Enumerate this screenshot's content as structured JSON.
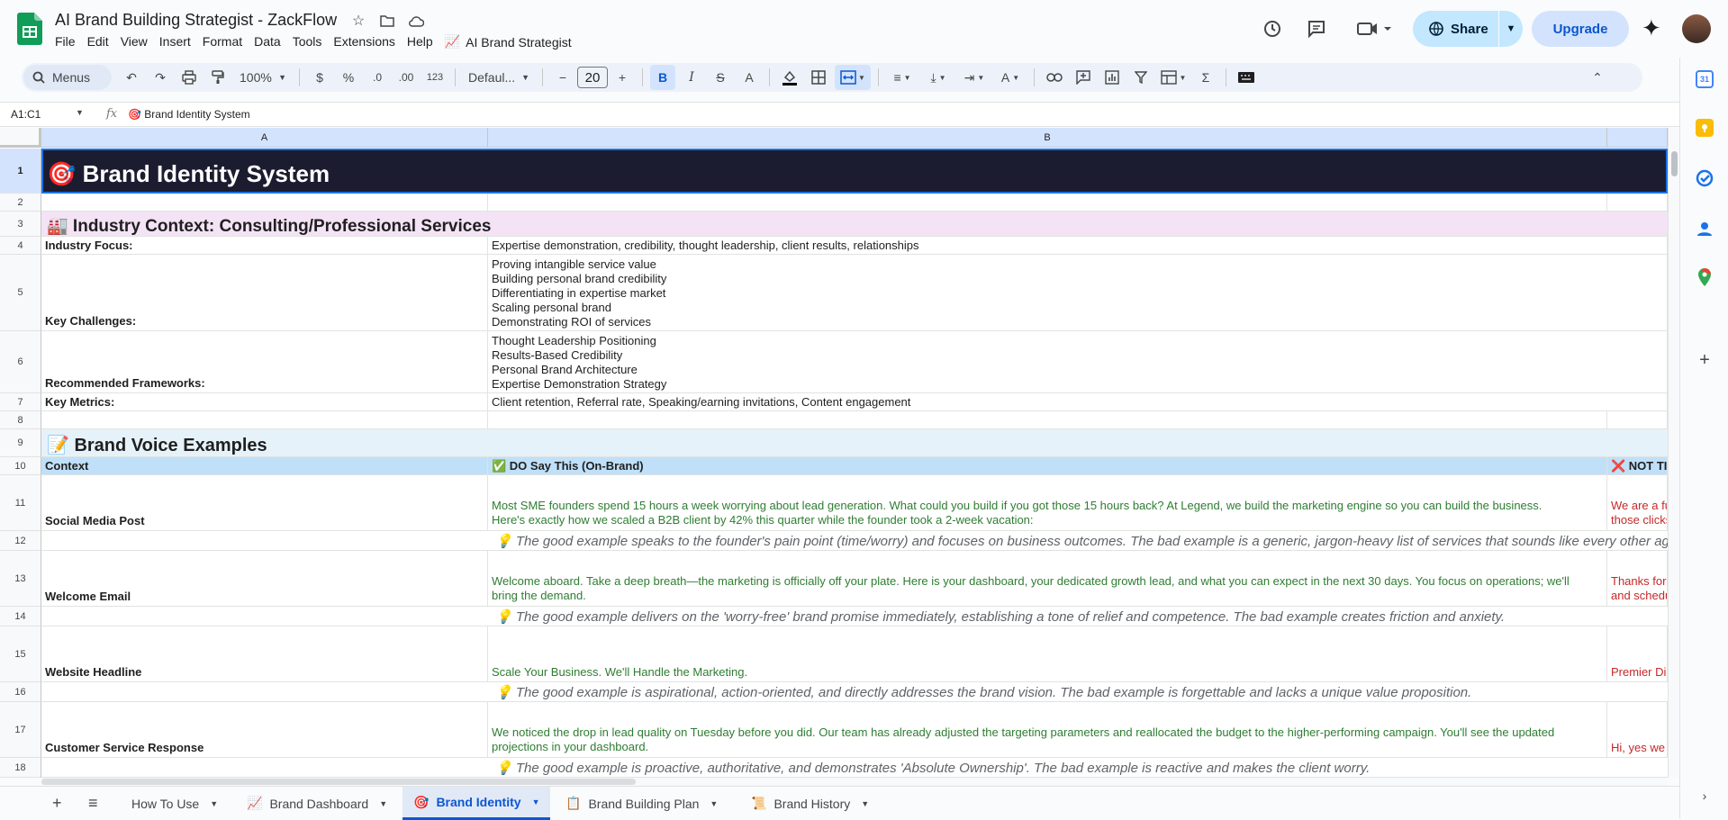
{
  "app": {
    "title": "AI Brand Building Strategist - ZackFlow",
    "menu": [
      "File",
      "Edit",
      "View",
      "Insert",
      "Format",
      "Data",
      "Tools",
      "Extensions",
      "Help"
    ],
    "extension_menu": "AI Brand Strategist",
    "share_label": "Share",
    "upgrade_label": "Upgrade"
  },
  "toolbar": {
    "menus_label": "Menus",
    "zoom": "100%",
    "currency": "$",
    "percent": "%",
    "dec_decrease": ".0",
    "dec_increase": ".00",
    "number_format": "123",
    "font": "Defaul...",
    "font_size": "20"
  },
  "formula_bar": {
    "name_box": "A1:C1",
    "fx": "fx",
    "content": "🎯 Brand Identity System"
  },
  "columns": [
    "A",
    "B"
  ],
  "rows": {
    "r1": {
      "num": "1",
      "text": "🎯 Brand Identity System"
    },
    "r2": {
      "num": "2"
    },
    "r3": {
      "num": "3",
      "text": "🏭 Industry Context: Consulting/Professional Services"
    },
    "r4": {
      "num": "4",
      "a": "Industry Focus:",
      "b": "Expertise demonstration, credibility, thought leadership, client results, relationships"
    },
    "r5": {
      "num": "5",
      "a": "Key Challenges:",
      "b": "Proving intangible service value\nBuilding personal brand credibility\nDifferentiating in expertise market\nScaling personal brand\nDemonstrating ROI of services"
    },
    "r6": {
      "num": "6",
      "a": "Recommended Frameworks:",
      "b": "Thought Leadership Positioning\nResults-Based Credibility\nPersonal Brand Architecture\nExpertise Demonstration Strategy"
    },
    "r7": {
      "num": "7",
      "a": "Key Metrics:",
      "b": "Client retention, Referral rate, Speaking/earning invitations, Content engagement"
    },
    "r8": {
      "num": "8"
    },
    "r9": {
      "num": "9",
      "text": "📝 Brand Voice Examples"
    },
    "r10": {
      "num": "10",
      "a": "Context",
      "b": "✅ DO Say This (On-Brand)",
      "c": "❌ NOT TI"
    },
    "r11": {
      "num": "11",
      "a": "Social Media Post",
      "b": "Most SME founders spend 15 hours a week worrying about lead generation. What could you build if you got those 15 hours back? At Legend, we build the marketing engine so you can build the business.\nHere's exactly how we scaled a B2B client by 42% this quarter while the founder took a 2-week vacation:",
      "c": "We are a fu\nthose clicks"
    },
    "r12": {
      "num": "12",
      "note": "💡 The good example speaks to the founder's pain point (time/worry) and focuses on business outcomes. The bad example is a generic, jargon-heavy list of services that sounds like every other agency."
    },
    "r13": {
      "num": "13",
      "a": "Welcome Email",
      "b": "Welcome aboard. Take a deep breath—the marketing is officially off your plate. Here is your dashboard, your dedicated growth lead, and what you can expect in the next 30 days. You focus on operations; we'll\nbring the demand.",
      "c": "Thanks for\nand schedu"
    },
    "r14": {
      "num": "14",
      "note": "💡 The good example delivers on the 'worry-free' brand promise immediately, establishing a tone of relief and competence. The bad example creates friction and anxiety."
    },
    "r15": {
      "num": "15",
      "a": "Website Headline",
      "b": "Scale Your Business. We'll Handle the Marketing.",
      "c": "Premier Dig"
    },
    "r16": {
      "num": "16",
      "note": "💡 The good example is aspirational, action-oriented, and directly addresses the brand vision. The bad example is forgettable and lacks a unique value proposition."
    },
    "r17": {
      "num": "17",
      "a": "Customer Service Response",
      "b": "We noticed the drop in lead quality on Tuesday before you did. Our team has already adjusted the targeting parameters and reallocated the budget to the higher-performing campaign. You'll see the updated\nprojections in your dashboard.",
      "c": "Hi, yes we"
    },
    "r18": {
      "num": "18",
      "note": "💡 The good example is proactive, authoritative, and demonstrates 'Absolute Ownership'. The bad example is reactive and makes the client worry."
    }
  },
  "sheets": [
    {
      "label": "How To Use",
      "icon": ""
    },
    {
      "label": "Brand Dashboard",
      "icon": "📈"
    },
    {
      "label": "Brand Identity",
      "icon": "🎯"
    },
    {
      "label": "Brand Building Plan",
      "icon": "📋"
    },
    {
      "label": "Brand History",
      "icon": "📜"
    }
  ],
  "colors": {
    "title_band": "#1c1c30",
    "industry_band": "#f3e3f5",
    "voice_band": "#e6f2fa",
    "header_row": "#bfe0f8",
    "good_text": "#2e7d32",
    "bad_text": "#c62828",
    "note_text": "#5f6368"
  }
}
